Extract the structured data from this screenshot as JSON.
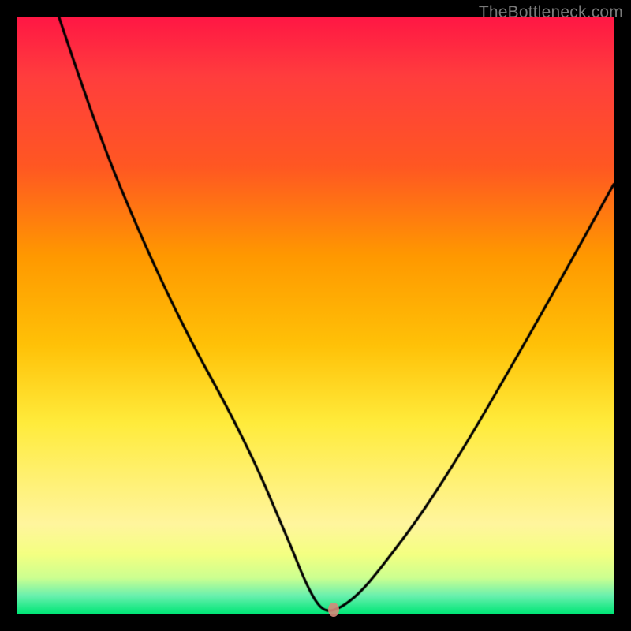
{
  "watermark": {
    "text": "TheBottleneck.com"
  },
  "chart_data": {
    "type": "line",
    "title": "",
    "xlabel": "",
    "ylabel": "",
    "xlim": [
      0,
      100
    ],
    "ylim": [
      0,
      100
    ],
    "grid": false,
    "series": [
      {
        "name": "curve",
        "x": [
          7,
          10,
          15,
          20,
          25,
          30,
          35,
          40,
          43,
          46,
          48,
          50,
          51.5,
          53,
          55,
          58,
          62,
          68,
          75,
          82,
          90,
          100
        ],
        "y": [
          100,
          91,
          77,
          65,
          54,
          44,
          35,
          25,
          18,
          11,
          6,
          2,
          0.5,
          0.5,
          1.5,
          4,
          9,
          17,
          28,
          40,
          54,
          72
        ]
      }
    ],
    "marker": {
      "x": 53,
      "y": 0.7,
      "color": "#d48a7a"
    },
    "background_gradient": {
      "top": "#ff1744",
      "mid": "#ffeb3b",
      "bottom": "#00e676"
    }
  }
}
